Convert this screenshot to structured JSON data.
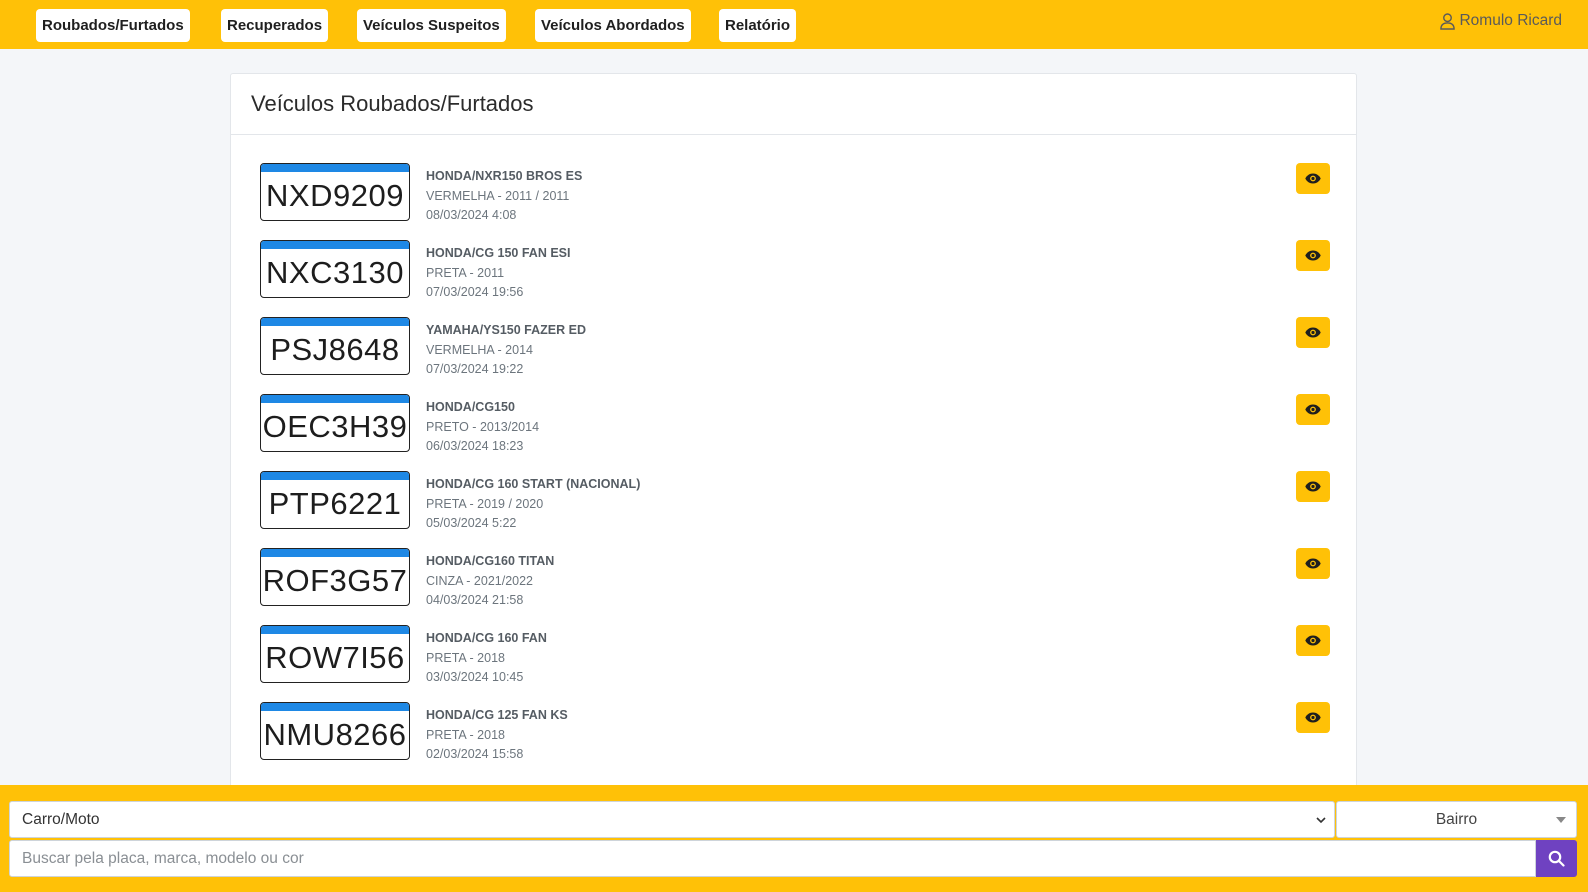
{
  "nav": {
    "items": [
      {
        "label": "Roubados/Furtados"
      },
      {
        "label": "Recuperados"
      },
      {
        "label": "Veículos Suspeitos"
      },
      {
        "label": "Veículos Abordados"
      },
      {
        "label": "Relatório"
      }
    ],
    "user_name": "Romulo Ricard"
  },
  "card": {
    "title": "Veículos Roubados/Furtados"
  },
  "vehicles": [
    {
      "plate": "NXD9209",
      "model": "HONDA/NXR150 BROS ES",
      "details": "VERMELHA - 2011 / 2011",
      "datetime": "08/03/2024 4:08"
    },
    {
      "plate": "NXC3130",
      "model": "HONDA/CG 150 FAN ESI",
      "details": "PRETA - 2011",
      "datetime": "07/03/2024 19:56"
    },
    {
      "plate": "PSJ8648",
      "model": "YAMAHA/YS150 FAZER ED",
      "details": "VERMELHA - 2014",
      "datetime": "07/03/2024 19:22"
    },
    {
      "plate": "OEC3H39",
      "model": "HONDA/CG150",
      "details": "PRETO - 2013/2014",
      "datetime": "06/03/2024 18:23"
    },
    {
      "plate": "PTP6221",
      "model": "HONDA/CG 160 START (NACIONAL)",
      "details": "PRETA - 2019 / 2020",
      "datetime": "05/03/2024 5:22"
    },
    {
      "plate": "ROF3G57",
      "model": "HONDA/CG160 TITAN",
      "details": "CINZA - 2021/2022",
      "datetime": "04/03/2024 21:58"
    },
    {
      "plate": "ROW7I56",
      "model": "HONDA/CG 160 FAN",
      "details": "PRETA - 2018",
      "datetime": "03/03/2024 10:45"
    },
    {
      "plate": "NMU8266",
      "model": "HONDA/CG 125 FAN KS",
      "details": "PRETA - 2018",
      "datetime": "02/03/2024 15:58"
    }
  ],
  "filters": {
    "type_selected": "Carro/Moto",
    "bairro_selected": "Bairro",
    "search_placeholder": "Buscar pela placa, marca, modelo ou cor"
  },
  "colors": {
    "accent": "#ffc107",
    "plate_strip": "#1e88e5",
    "search_button": "#6f42c1"
  },
  "icons": {
    "user": "user-icon",
    "view": "eye-icon",
    "search": "search-icon",
    "dropdown": "chevron-down-icon"
  }
}
